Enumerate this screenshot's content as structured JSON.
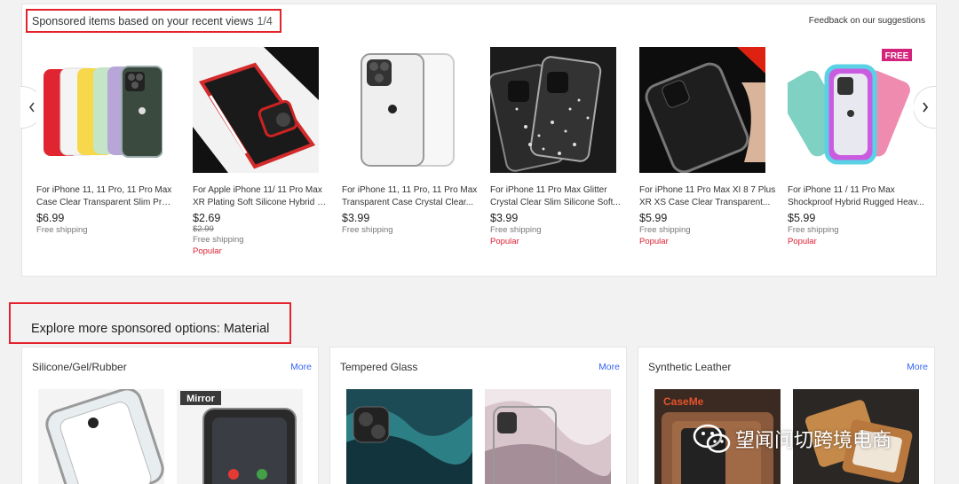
{
  "sponsored": {
    "title": "Sponsored items based on your recent views",
    "page": "1/4",
    "feedback": "Feedback on our suggestions",
    "prev_icon": "chevron-left-icon",
    "next_icon": "chevron-right-icon",
    "items": [
      {
        "line1": "For iPhone 11, 11 Pro, 11 Pro Max",
        "line2": "Case Clear Transparent Slim Pro...",
        "price": "$6.99",
        "was": "",
        "shipping": "Free shipping",
        "badge": ""
      },
      {
        "line1": "For Apple iPhone 11/ 11 Pro Max",
        "line2": "XR Plating Soft Silicone Hybrid C...",
        "price": "$2.69",
        "was": "$2.99",
        "shipping": "Free shipping",
        "badge": "Popular"
      },
      {
        "line1": "For iPhone 11, 11 Pro, 11 Pro Max",
        "line2": "Transparent Case Crystal Clear...",
        "price": "$3.99",
        "was": "",
        "shipping": "Free shipping",
        "badge": ""
      },
      {
        "line1": "For iPhone 11 Pro Max Glitter",
        "line2": "Crystal Clear Slim Silicone Soft...",
        "price": "$3.99",
        "was": "",
        "shipping": "Free shipping",
        "badge": "Popular"
      },
      {
        "line1": "For iPhone 11 Pro Max XI 8 7 Plus",
        "line2": "XR XS Case Clear Transparent...",
        "price": "$5.99",
        "was": "",
        "shipping": "Free shipping",
        "badge": "Popular"
      },
      {
        "line1": "For iPhone 11 / 11 Pro Max",
        "line2": "Shockproof Hybrid Rugged Heav...",
        "price": "$5.99",
        "was": "",
        "shipping": "Free shipping",
        "badge": "Popular"
      }
    ]
  },
  "explore": {
    "title": "Explore more sponsored options: Material",
    "categories": [
      {
        "name": "Silicone/Gel/Rubber",
        "more": "More"
      },
      {
        "name": "Tempered Glass",
        "more": "More"
      },
      {
        "name": "Synthetic Leather",
        "more": "More"
      }
    ]
  },
  "image_text": {
    "free_tag": "FREE",
    "mirror_tag": "Mirror",
    "caseme_tag": "CaseMe"
  },
  "watermark": "望闻问切跨境电商",
  "colors": {
    "highlight_box": "#e3232c",
    "popular": "#dd1e31",
    "more_link": "#3665f3"
  }
}
